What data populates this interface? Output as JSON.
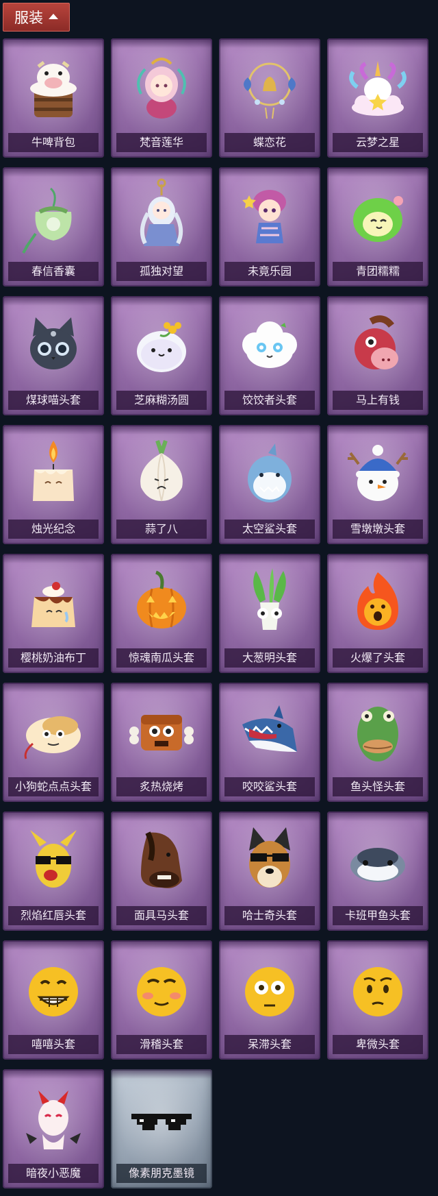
{
  "header": {
    "title": "服装",
    "icon": "chevron-up-icon"
  },
  "items": [
    {
      "label": "牛啤背包",
      "icon": "cow-beer-backpack-icon",
      "theme": "purple"
    },
    {
      "label": "梵音莲华",
      "icon": "lotus-doll-icon",
      "theme": "purple"
    },
    {
      "label": "蝶恋花",
      "icon": "butterfly-bell-icon",
      "theme": "purple"
    },
    {
      "label": "云梦之星",
      "icon": "unicorn-cloud-icon",
      "theme": "purple"
    },
    {
      "label": "春信香囊",
      "icon": "sachet-icon",
      "theme": "purple"
    },
    {
      "label": "孤独对望",
      "icon": "keychain-doll-icon",
      "theme": "purple"
    },
    {
      "label": "未竟乐园",
      "icon": "jester-doll-icon",
      "theme": "purple"
    },
    {
      "label": "青团糯糯",
      "icon": "green-dumpling-icon",
      "theme": "purple"
    },
    {
      "label": "煤球喵头套",
      "icon": "black-cat-head-icon",
      "theme": "purple"
    },
    {
      "label": "芝麻糊汤圆",
      "icon": "rice-ball-icon",
      "theme": "purple"
    },
    {
      "label": "饺饺者头套",
      "icon": "cloud-dumpling-icon",
      "theme": "purple"
    },
    {
      "label": "马上有钱",
      "icon": "red-horse-icon",
      "theme": "purple"
    },
    {
      "label": "烛光纪念",
      "icon": "candle-icon",
      "theme": "purple"
    },
    {
      "label": "蒜了八",
      "icon": "garlic-icon",
      "theme": "purple"
    },
    {
      "label": "太空鲨头套",
      "icon": "space-shark-icon",
      "theme": "purple"
    },
    {
      "label": "雪墩墩头套",
      "icon": "snowman-icon",
      "theme": "purple"
    },
    {
      "label": "樱桃奶油布丁",
      "icon": "pudding-icon",
      "theme": "purple"
    },
    {
      "label": "惊魂南瓜头套",
      "icon": "pumpkin-icon",
      "theme": "purple"
    },
    {
      "label": "大葱明头套",
      "icon": "scallion-icon",
      "theme": "purple"
    },
    {
      "label": "火爆了头套",
      "icon": "flame-icon",
      "theme": "purple"
    },
    {
      "label": "小狗蛇点点头套",
      "icon": "dog-snake-icon",
      "theme": "purple"
    },
    {
      "label": "炙热烧烤",
      "icon": "sausage-icon",
      "theme": "purple"
    },
    {
      "label": "咬咬鲨头套",
      "icon": "biting-shark-icon",
      "theme": "purple"
    },
    {
      "label": "鱼头怪头套",
      "icon": "fish-head-icon",
      "theme": "purple"
    },
    {
      "label": "烈焰红唇头套",
      "icon": "yellow-sunglasses-icon",
      "theme": "purple"
    },
    {
      "label": "面具马头套",
      "icon": "horse-mask-icon",
      "theme": "purple"
    },
    {
      "label": "哈士奇头套",
      "icon": "husky-icon",
      "theme": "purple"
    },
    {
      "label": "卡班甲鱼头套",
      "icon": "armored-fish-icon",
      "theme": "purple"
    },
    {
      "label": "嘻嘻头套",
      "icon": "grin-emoji-icon",
      "theme": "purple"
    },
    {
      "label": "滑稽头套",
      "icon": "silly-emoji-icon",
      "theme": "purple"
    },
    {
      "label": "呆滞头套",
      "icon": "stunned-emoji-icon",
      "theme": "purple"
    },
    {
      "label": "卑微头套",
      "icon": "humble-emoji-icon",
      "theme": "purple"
    },
    {
      "label": "暗夜小恶魔",
      "icon": "little-devil-icon",
      "theme": "purple"
    },
    {
      "label": "像素朋克墨镜",
      "icon": "pixel-sunglasses-icon",
      "theme": "silver"
    }
  ],
  "colors": {
    "background": "#0d1420",
    "header": "#a8383a",
    "card_purple": "#9a72ad",
    "card_silver": "#a2afbd"
  }
}
